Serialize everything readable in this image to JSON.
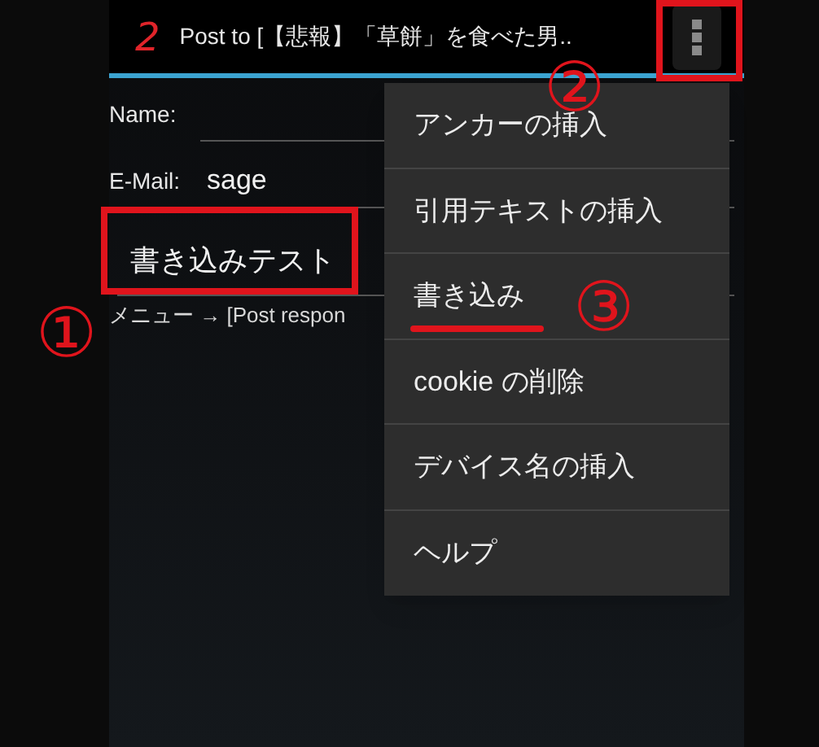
{
  "action_bar": {
    "logo": "2",
    "title": "Post to [【悲報】「草餅」を食べた男..",
    "overflow_menu_open": true
  },
  "form": {
    "fields": [
      {
        "label": "Name:"
      },
      {
        "label": "E-Mail:",
        "value": "sage"
      }
    ],
    "message": {
      "value": "書き込みテスト"
    },
    "hint": "メニュー → [Post respon"
  },
  "menu": {
    "items": [
      {
        "label": "アンカーの挿入",
        "marked": false
      },
      {
        "label": "引用テキストの挿入",
        "marked": false
      },
      {
        "label": "書き込み",
        "marked": true
      },
      {
        "label": "cookie の削除",
        "marked": false
      },
      {
        "label": "デバイス名の挿入",
        "marked": false
      },
      {
        "label": "ヘルプ",
        "marked": false
      }
    ]
  },
  "annotations": [
    {
      "label": "①"
    },
    {
      "label": "②"
    },
    {
      "label": "③"
    }
  ]
}
